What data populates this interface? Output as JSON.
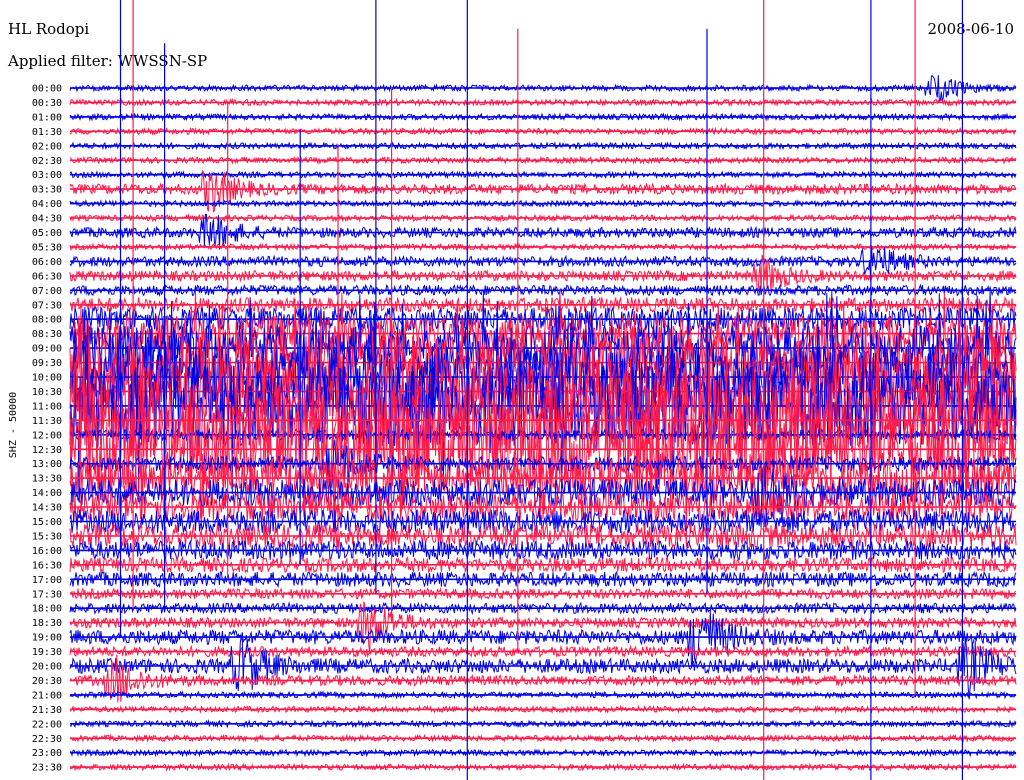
{
  "header": {
    "station": "HL Rodopi",
    "date": "2008-06-10",
    "filter_label": "Applied filter: WWSSN-SP"
  },
  "colors": {
    "even_trace": "#0000e6",
    "odd_trace": "#ff1a4a",
    "background": "#ffffff",
    "text": "#000000"
  },
  "chart_data": {
    "type": "line",
    "title": "",
    "xlabel": "",
    "ylabel": "SHZ - 50000",
    "xlim": [
      0,
      30
    ],
    "grid": false,
    "legend": "none",
    "row_labels": [
      "00:00",
      "00:30",
      "01:00",
      "01:30",
      "02:00",
      "02:30",
      "03:00",
      "03:30",
      "04:00",
      "04:30",
      "05:00",
      "05:30",
      "06:00",
      "06:30",
      "07:00",
      "07:30",
      "08:00",
      "08:30",
      "09:00",
      "09:30",
      "10:00",
      "10:30",
      "11:00",
      "11:30",
      "12:00",
      "12:30",
      "13:00",
      "13:30",
      "14:00",
      "14:30",
      "15:00",
      "15:30",
      "16:00",
      "16:30",
      "17:00",
      "17:30",
      "18:00",
      "18:30",
      "19:00",
      "19:30",
      "20:00",
      "20:30",
      "21:00",
      "21:30",
      "22:00",
      "22:30",
      "23:00",
      "23:30"
    ],
    "series_colors": [
      "#0000e6",
      "#ff1a4a"
    ],
    "activity_profile": [
      1,
      1,
      1,
      1,
      1,
      1,
      1,
      2,
      1,
      1,
      2,
      1,
      2,
      2,
      2,
      3,
      5,
      8,
      10,
      12,
      14,
      16,
      18,
      18,
      2,
      18,
      3,
      8,
      6,
      6,
      5,
      5,
      4,
      3,
      3,
      2,
      2,
      2,
      3,
      2,
      3,
      2,
      1,
      1,
      1,
      1,
      1,
      1
    ],
    "events": [
      {
        "row": 0,
        "t": 27.5,
        "amp": 1.5
      },
      {
        "row": 7,
        "t": 4.5,
        "amp": 2.5
      },
      {
        "row": 10,
        "t": 4.5,
        "amp": 2
      },
      {
        "row": 12,
        "t": 25.5,
        "amp": 2
      },
      {
        "row": 13,
        "t": 22,
        "amp": 2
      },
      {
        "row": 26,
        "t": 8.5,
        "amp": 2.5
      },
      {
        "row": 28,
        "t": 22,
        "amp": 3
      },
      {
        "row": 37,
        "t": 9.5,
        "amp": 3
      },
      {
        "row": 38,
        "t": 20,
        "amp": 4
      },
      {
        "row": 40,
        "t": 5.5,
        "amp": 3
      },
      {
        "row": 40,
        "t": 28.5,
        "amp": 3
      },
      {
        "row": 41,
        "t": 1.5,
        "amp": 2.5
      }
    ],
    "spikes": [
      {
        "t": 1.6,
        "from_row": 0,
        "to_row": 38
      },
      {
        "t": 2.0,
        "from_row": 0,
        "to_row": 36
      },
      {
        "t": 3.0,
        "from_row": 3,
        "to_row": 36
      },
      {
        "t": 5.0,
        "from_row": 7,
        "to_row": 34
      },
      {
        "t": 7.3,
        "from_row": 9,
        "to_row": 33
      },
      {
        "t": 8.5,
        "from_row": 10,
        "to_row": 32
      },
      {
        "t": 9.7,
        "from_row": 0,
        "to_row": 35
      },
      {
        "t": 10.2,
        "from_row": 6,
        "to_row": 37
      },
      {
        "t": 12.6,
        "from_row": 0,
        "to_row": 48
      },
      {
        "t": 14.2,
        "from_row": 2,
        "to_row": 39
      },
      {
        "t": 20.2,
        "from_row": 2,
        "to_row": 35
      },
      {
        "t": 22.0,
        "from_row": 0,
        "to_row": 48
      },
      {
        "t": 25.4,
        "from_row": 0,
        "to_row": 48
      },
      {
        "t": 26.8,
        "from_row": 0,
        "to_row": 42
      },
      {
        "t": 28.3,
        "from_row": 0,
        "to_row": 48
      }
    ]
  }
}
